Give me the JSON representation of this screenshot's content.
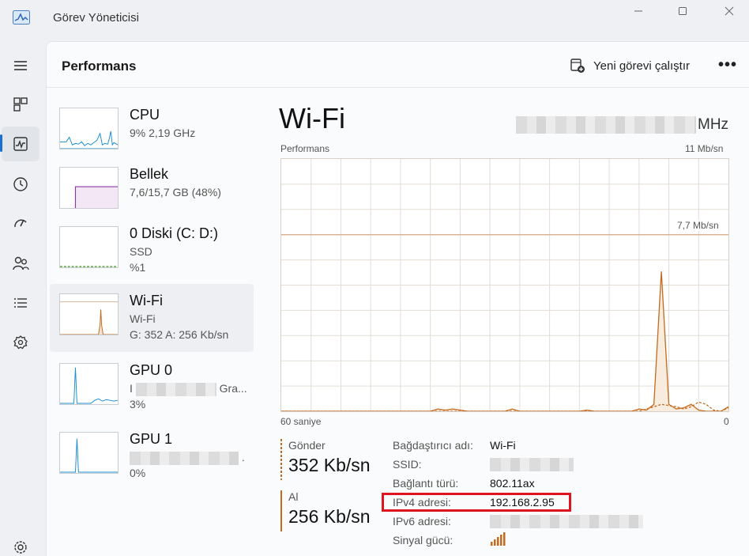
{
  "window": {
    "title": "Görev Yöneticisi",
    "controls": [
      "minimize-icon",
      "maximize-icon",
      "close-icon"
    ]
  },
  "rail": [
    {
      "icon": "hamburger-menu-icon"
    },
    {
      "icon": "processes-icon"
    },
    {
      "icon": "performance-icon",
      "active": true
    },
    {
      "icon": "app-history-icon"
    },
    {
      "icon": "startup-apps-icon"
    },
    {
      "icon": "users-icon"
    },
    {
      "icon": "details-icon"
    },
    {
      "icon": "services-icon"
    },
    {
      "icon": "settings-gear-icon"
    }
  ],
  "header": {
    "title": "Performans",
    "run_task": "Yeni görevi çalıştır",
    "more": "•••"
  },
  "devices": [
    {
      "name": "CPU",
      "line1": "9% 2,19 GHz",
      "line2": ""
    },
    {
      "name": "Bellek",
      "line1": "7,6/15,7 GB (48%)",
      "line2": ""
    },
    {
      "name": "0 Diski (C: D:)",
      "line1": "SSD",
      "line2": "%1"
    },
    {
      "name": "Wi-Fi",
      "line1": "Wi-Fi",
      "line2": "G: 352 A: 256 Kb/sn"
    },
    {
      "name": "GPU 0",
      "line1_prefix": "I",
      "line1_suffix": "Gra...",
      "line2": "3%"
    },
    {
      "name": "GPU 1",
      "line1_suffix": ".",
      "line2": "0%"
    }
  ],
  "detail": {
    "title": "Wi-Fi",
    "right_unit": "MHz",
    "perf_label": "Performans",
    "max_label": "11 Mb/sn",
    "gridline_label": "7,7 Mb/sn",
    "time_left": "60 saniye",
    "time_right": "0",
    "send_label": "Gönder",
    "send_value": "352 Kb/sn",
    "recv_label": "Al",
    "recv_value": "256 Kb/sn",
    "props": {
      "adapter_k": "Bağdaştırıcı adı:",
      "adapter_v": "Wi-Fi",
      "ssid_k": "SSID:",
      "conn_k": "Bağlantı türü:",
      "conn_v": "802.11ax",
      "ipv4_k": "IPv4 adresi:",
      "ipv4_v": "192.168.2.95",
      "ipv6_k": "IPv6 adresi:",
      "signal_k": "Sinyal gücü:"
    }
  },
  "chart_data": {
    "type": "line",
    "title": "",
    "xlabel": "",
    "ylabel": "",
    "xlim": [
      60,
      0
    ],
    "ylim": [
      0,
      11
    ],
    "reference_line": 7.7,
    "series": [
      {
        "name": "",
        "x": [
          60,
          40,
          39,
          38,
          37,
          36,
          35,
          30,
          29,
          28,
          20,
          19,
          18,
          13,
          12,
          11,
          10,
          9,
          8,
          7,
          6,
          5,
          4,
          3,
          2,
          1,
          0
        ],
        "values": [
          0,
          0,
          0.1,
          0.05,
          0.1,
          0.05,
          0,
          0,
          0.1,
          0,
          0,
          0.05,
          0,
          0,
          0.1,
          0.05,
          0.3,
          6.1,
          0.3,
          0.1,
          0.15,
          0.3,
          0.05,
          0,
          0,
          0,
          0.2
        ]
      },
      {
        "name": "",
        "x": [
          60,
          12,
          11,
          10,
          9,
          8,
          7,
          6,
          5,
          4,
          3,
          2,
          1,
          0
        ],
        "values": [
          0,
          0,
          0.1,
          0.2,
          0.3,
          0.25,
          0.2,
          0.1,
          0.2,
          0.4,
          0.3,
          0.05,
          0,
          0.15
        ]
      }
    ],
    "colors": {
      "line": "#c46a1c",
      "grid": "#e3ddd6",
      "reference": "#d9b497"
    }
  }
}
